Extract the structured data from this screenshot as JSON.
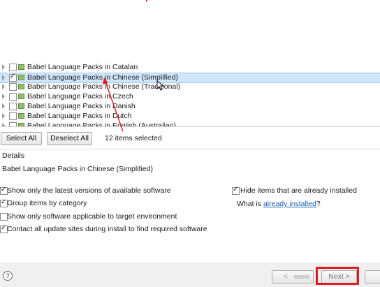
{
  "packages": [
    {
      "label": "Babel Language Packs in Catalan",
      "checked": false,
      "selected": false
    },
    {
      "label": "Babel Language Packs in Chinese (Simplified)",
      "checked": true,
      "selected": true
    },
    {
      "label": "Babel Language Packs in Chinese (Traditional)",
      "checked": false,
      "selected": false
    },
    {
      "label": "Babel Language Packs in Czech",
      "checked": false,
      "selected": false
    },
    {
      "label": "Babel Language Packs in Danish",
      "checked": false,
      "selected": false
    },
    {
      "label": "Babel Language Packs in Dutch",
      "checked": false,
      "selected": false
    },
    {
      "label": "Babel Language Packs in English (Australian)",
      "checked": false,
      "selected": false
    }
  ],
  "selection": {
    "select_all_label": "Select All",
    "deselect_all_label": "Deselect All",
    "count_text": "12 items selected"
  },
  "details": {
    "heading": "Details",
    "text": "Babel Language Packs in Chinese (Simplified)"
  },
  "options": {
    "latest_only": {
      "label": "Show only the latest versions of available software",
      "checked": true
    },
    "group_by_category": {
      "label": "Group items by category",
      "checked": true
    },
    "target_env_only": {
      "label": "Show only software applicable to target environment",
      "checked": false
    },
    "contact_sites": {
      "label": "Contact all update sites during install to find required software",
      "checked": true
    },
    "hide_installed": {
      "label": "Hide items that are already installed",
      "checked": true
    },
    "what_is_prefix": "What is ",
    "what_is_link": "already installed",
    "what_is_suffix": "?"
  },
  "footer": {
    "help_icon": "?",
    "back_label": "<",
    "next_label": "Next >"
  },
  "colors": {
    "selection_bg": "#cfe6fb",
    "highlight": "#e01b24",
    "link": "#1a5fb4"
  }
}
